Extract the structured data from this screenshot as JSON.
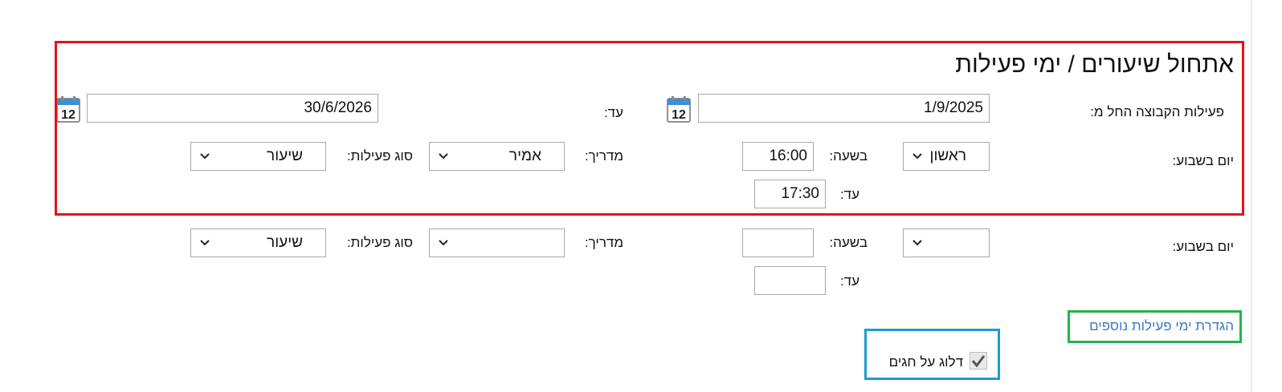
{
  "form": {
    "title": "אתחול שיעורים / ימי פעילות",
    "start_label": "פעילות הקבוצה החל מ:",
    "start_date": "1/9/2025",
    "end_label": "עד:",
    "end_date": "30/6/2026",
    "calendar_icon_text": "12"
  },
  "schedule_rows": [
    {
      "weekday_label": "יום בשבוע:",
      "weekday_value": "ראשון",
      "time_label": "בשעה:",
      "time_value": "16:00",
      "until_label": "עד:",
      "until_value": "17:30",
      "instructor_label": "מדריך:",
      "instructor_value": "אמיר",
      "activity_type_label": "סוג פעילות:",
      "activity_type_value": "שיעור"
    },
    {
      "weekday_label": "יום בשבוע:",
      "weekday_value": "",
      "time_label": "בשעה:",
      "time_value": "",
      "until_label": "עד:",
      "until_value": "",
      "instructor_label": "מדריך:",
      "instructor_value": "",
      "activity_type_label": "סוג פעילות:",
      "activity_type_value": "שיעור"
    }
  ],
  "add_more_link": "הגדרת ימי פעילות נוספים",
  "skip_holidays": {
    "label": "דלוג על חגים",
    "checked": true
  },
  "colors": {
    "highlight_red": "#e0141e",
    "highlight_green": "#26b34a",
    "highlight_blue": "#1e9ad6",
    "link": "#3a78c2"
  }
}
